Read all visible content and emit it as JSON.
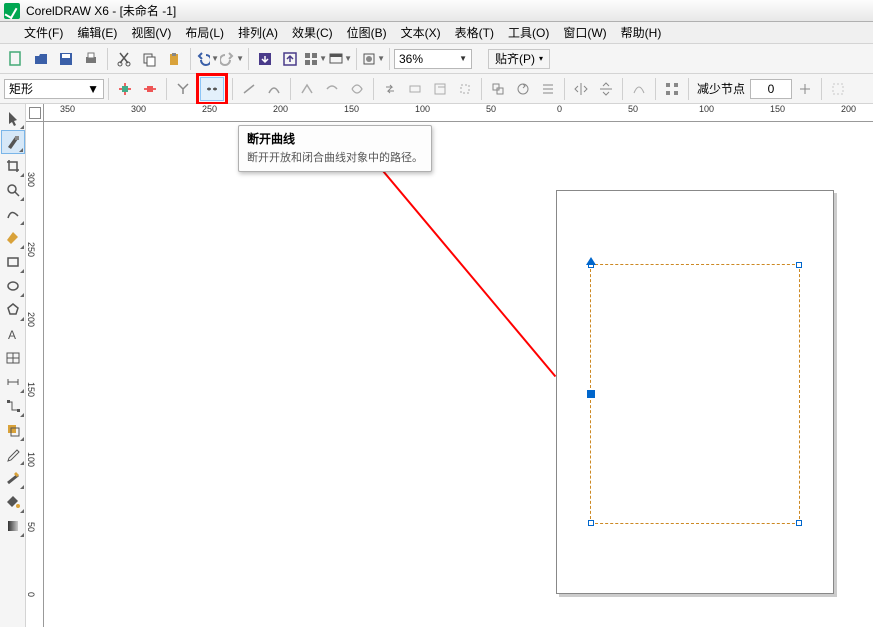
{
  "title": "CorelDRAW X6 - [未命名 -1]",
  "menu": [
    "文件(F)",
    "编辑(E)",
    "视图(V)",
    "布局(L)",
    "排列(A)",
    "效果(C)",
    "位图(B)",
    "文本(X)",
    "表格(T)",
    "工具(O)",
    "窗口(W)",
    "帮助(H)"
  ],
  "zoom_value": "36%",
  "snap_label": "贴齐(P)",
  "shape_dropdown": "矩形",
  "reduce_nodes_label": "减少节点",
  "reduce_nodes_value": "0",
  "tooltip": {
    "title": "断开曲线",
    "body": "断开开放和闭合曲线对象中的路径。"
  },
  "ruler_h": [
    "350",
    "300",
    "250",
    "200",
    "150",
    "100",
    "50",
    "0",
    "50",
    "100",
    "150",
    "200"
  ],
  "ruler_v": [
    "300",
    "250",
    "200",
    "150",
    "100",
    "50",
    "0"
  ],
  "icons": {
    "new": "□",
    "open": "📁",
    "save": "💾",
    "print": "🖶",
    "cut": "✂",
    "copy": "⧉",
    "paste": "📋",
    "undo": "↶",
    "redo": "↷",
    "import": "⬇",
    "export": "⬆",
    "app": "▦",
    "pdf": "🖹",
    "zoomfit": "⛶",
    "img": "🖼"
  }
}
